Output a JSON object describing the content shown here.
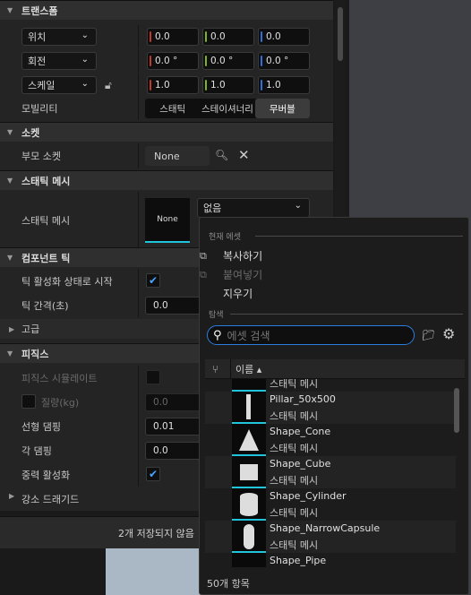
{
  "sections": {
    "transform": "트랜스폼",
    "socket": "소켓",
    "static_mesh": "스태틱 메시",
    "component_tick": "컴포넌트 틱",
    "advanced": "고급",
    "physics": "피직스"
  },
  "transform": {
    "location": {
      "label": "위치",
      "x": "0.0",
      "y": "0.0",
      "z": "0.0"
    },
    "rotation": {
      "label": "회전",
      "x": "0.0 °",
      "y": "0.0 °",
      "z": "0.0 °"
    },
    "scale": {
      "label": "스케일",
      "x": "1.0",
      "y": "1.0",
      "z": "1.0"
    },
    "mobility": {
      "label": "모빌리티",
      "options": [
        "스태틱",
        "스테이셔너리",
        "무버블"
      ],
      "selected": "무버블"
    }
  },
  "socket": {
    "parent_label": "부모 소켓",
    "parent_value": "None"
  },
  "static_mesh": {
    "label": "스태틱 메시",
    "thumb_text": "None",
    "dropdown_value": "없음"
  },
  "tick": {
    "start_enabled_label": "틱 활성화 상태로 시작",
    "start_enabled": true,
    "interval_label": "틱 간격(초)",
    "interval_value": "0.0"
  },
  "physics": {
    "simulate_label": "피직스 시뮬레이트",
    "mass_label": "질량(kg)",
    "mass_value": "0.0",
    "linear_damping_label": "선형 댐핑",
    "linear_damping_value": "0.01",
    "angular_damping_label": "각 댐핑",
    "angular_damping_value": "0.0",
    "gravity_label": "중력 활성화",
    "gravity_enabled": true,
    "cut_label": "강소 드래기드"
  },
  "bottom_bar": {
    "save_text": "2개 저장되지 않음"
  },
  "popup": {
    "current_asset_header": "현재 에셋",
    "copy": "복사하기",
    "paste": "붙여넣기",
    "delete": "지우기",
    "browse_header": "탐색",
    "search_placeholder": "에셋 검색",
    "column_name": "이름",
    "items": [
      {
        "name": "",
        "kind": "스태틱 메시"
      },
      {
        "name": "Pillar_50x500",
        "kind": "스태틱 메시"
      },
      {
        "name": "Shape_Cone",
        "kind": "스태틱 메시"
      },
      {
        "name": "Shape_Cube",
        "kind": "스태틱 메시"
      },
      {
        "name": "Shape_Cylinder",
        "kind": "스태틱 메시"
      },
      {
        "name": "Shape_NarrowCapsule",
        "kind": "스태틱 메시"
      },
      {
        "name": "Shape_Pipe",
        "kind": ""
      }
    ],
    "count": "50개 항목"
  },
  "colors": {
    "accent": "#2d7de0",
    "thumb_underline": "#22c4dc",
    "x_axis": "#c0392b",
    "y_axis": "#7cb32a",
    "z_axis": "#2e6fd8"
  }
}
